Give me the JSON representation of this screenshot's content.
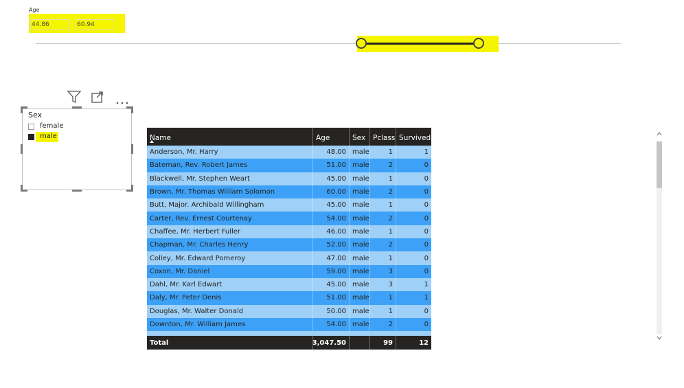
{
  "age_slicer": {
    "title": "Age",
    "min_value": "44.86",
    "max_value": "60.94",
    "colors": {
      "highlight": "#f5f500",
      "track": "#c8c6c4",
      "fill": "#252423"
    }
  },
  "header_icons": [
    "filter-icon",
    "focus-mode-icon",
    "more-options-icon"
  ],
  "sex_slicer": {
    "title": "Sex",
    "options": [
      {
        "label": "female",
        "selected": false
      },
      {
        "label": "male",
        "selected": true
      }
    ]
  },
  "table": {
    "columns": [
      "Name",
      "Age",
      "Sex",
      "Pclass",
      "Survived"
    ],
    "sort_column": "Name",
    "rows": [
      [
        "Anderson, Mr. Harry",
        "48.00",
        "male",
        "1",
        "1"
      ],
      [
        "Bateman, Rev. Robert James",
        "51.00",
        "male",
        "2",
        "0"
      ],
      [
        "Blackwell, Mr. Stephen Weart",
        "45.00",
        "male",
        "1",
        "0"
      ],
      [
        "Brown, Mr. Thomas William Solomon",
        "60.00",
        "male",
        "2",
        "0"
      ],
      [
        "Butt, Major. Archibald Willingham",
        "45.00",
        "male",
        "1",
        "0"
      ],
      [
        "Carter, Rev. Ernest Courtenay",
        "54.00",
        "male",
        "2",
        "0"
      ],
      [
        "Chaffee, Mr. Herbert Fuller",
        "46.00",
        "male",
        "1",
        "0"
      ],
      [
        "Chapman, Mr. Charles Henry",
        "52.00",
        "male",
        "2",
        "0"
      ],
      [
        "Colley, Mr. Edward Pomeroy",
        "47.00",
        "male",
        "1",
        "0"
      ],
      [
        "Coxon, Mr. Daniel",
        "59.00",
        "male",
        "3",
        "0"
      ],
      [
        "Dahl, Mr. Karl Edwart",
        "45.00",
        "male",
        "3",
        "1"
      ],
      [
        "Daly, Mr. Peter Denis",
        "51.00",
        "male",
        "1",
        "1"
      ],
      [
        "Douglas, Mr. Walter Donald",
        "50.00",
        "male",
        "1",
        "0"
      ],
      [
        "Downton, Mr. William James",
        "54.00",
        "male",
        "2",
        "0"
      ]
    ],
    "total": {
      "label": "Total",
      "age": "3,047.50",
      "sex": "",
      "pclass": "99",
      "survived": "12"
    },
    "colors": {
      "header": "#252423",
      "row_light": "#9fd0f7",
      "row_dark": "#3da2f7"
    }
  }
}
